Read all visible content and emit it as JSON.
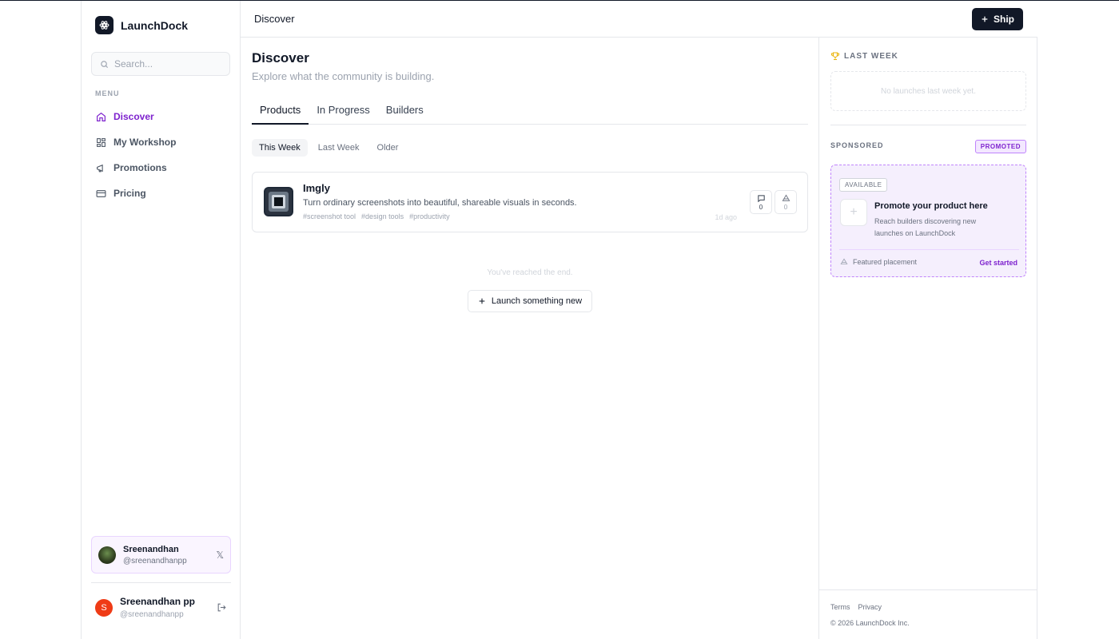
{
  "brand": {
    "name": "LaunchDock"
  },
  "search": {
    "placeholder": "Search..."
  },
  "sidebar": {
    "menu_label": "MENU",
    "items": [
      {
        "label": "Discover",
        "icon": "home-icon",
        "active": true
      },
      {
        "label": "My Workshop",
        "icon": "grid-icon"
      },
      {
        "label": "Promotions",
        "icon": "megaphone-icon"
      },
      {
        "label": "Pricing",
        "icon": "credit-card-icon"
      }
    ],
    "profile_card": {
      "name": "Sreenandhan",
      "handle": "@sreenandhanpp",
      "social_icon": "𝕏"
    },
    "user": {
      "initial": "S",
      "name": "Sreenandhan pp",
      "handle": "@sreenandhanpp"
    }
  },
  "topbar": {
    "title": "Discover",
    "ship_label": "Ship"
  },
  "main": {
    "title": "Discover",
    "subtitle": "Explore what the community is building.",
    "tabs": [
      "Products",
      "In Progress",
      "Builders"
    ],
    "filters": [
      "This Week",
      "Last Week",
      "Older"
    ],
    "products": [
      {
        "name": "Imgly",
        "description": "Turn ordinary screenshots into beautiful, shareable visuals in seconds.",
        "tags": [
          "#screenshot tool",
          "#design tools",
          "#productivity"
        ],
        "time": "1d ago",
        "comments": "0",
        "upvotes": "0"
      }
    ],
    "end_text": "You've reached the end.",
    "launch_label": "Launch something new"
  },
  "rightbar": {
    "last_week_heading": "LAST WEEK",
    "last_week_empty": "No launches last week yet.",
    "sponsored_label": "SPONSORED",
    "promoted_badge": "PROMOTED",
    "promo": {
      "badge": "AVAILABLE",
      "title": "Promote your product here",
      "description": "Reach builders discovering new launches on LaunchDock",
      "featured": "Featured placement",
      "cta": "Get started"
    },
    "footer": {
      "links": [
        "Terms",
        "Privacy"
      ],
      "copyright": "© 2026 LaunchDock Inc."
    }
  },
  "colors": {
    "accent": "#7e22ce",
    "dark": "#111827",
    "avatar": "#ef3b16"
  }
}
